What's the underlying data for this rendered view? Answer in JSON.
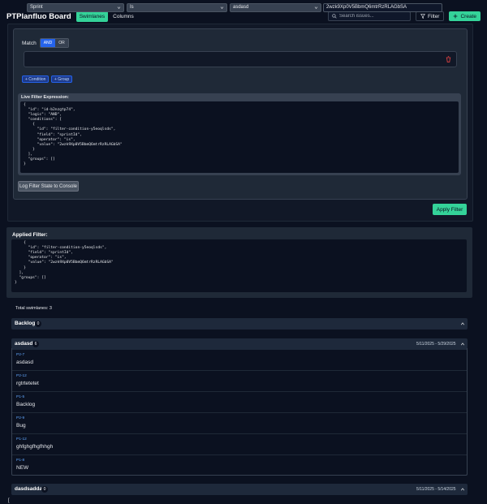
{
  "header": {
    "title": "PTPlanfluo Board",
    "views": [
      "Swimlanes",
      "Columns"
    ],
    "active_view": "Swimlanes",
    "search_placeholder": "Search issues...",
    "filter_label": "Filter",
    "create_label": "Create"
  },
  "builder": {
    "match_label": "Match",
    "logic_options": [
      "AND",
      "OR"
    ],
    "active_logic": "AND",
    "condition": {
      "field": "Sprint",
      "operator": "Is",
      "value_select": "asdasd",
      "value_input": "2wzk9Xp0V5BbmQ6mtrRzRLAGbSA"
    },
    "add_condition_label": "+ Condition",
    "add_group_label": "+ Group",
    "live_title": "Live Filter Expression:",
    "live_json": "{\n  \"id\": \"id-b2nzgtp74\",\n  \"logic\": \"AND\",\n  \"conditions\": [\n    {\n      \"id\": \"filter-condition-y5eoqlsds\",\n      \"field\": \"sprintId\",\n      \"operator\": \"is\",\n      \"value\": \"2wzk9Xp0V5BbmQ6mtrRzRLAGbSA\"\n    }\n  ],\n  \"groups\": []\n}",
    "log_label": "Log Filter State to Console",
    "apply_label": "Apply Filter"
  },
  "applied": {
    "title": "Applied Filter:",
    "json": "  \"conditions\": [\n    {\n      \"id\": \"filter-condition-y5eoqlsds\",\n      \"field\": \"sprintId\",\n      \"operator\": \"is\",\n      \"value\": \"2wzk9Xp0V5BbmQ6mtrRzRLAGbSA\"\n    }\n  ],\n  \"groups\": []\n}"
  },
  "total_text": "Total swimlanes: 3",
  "lanes": [
    {
      "name": "Backlog",
      "count": "0",
      "dates": ""
    },
    {
      "name": "asdasd",
      "count": "6",
      "dates": "5/11/2025 - 5/29/2025"
    },
    {
      "name": "dasdsadda",
      "count": "0",
      "dates": "5/11/2025 - 5/14/2025"
    }
  ],
  "issues": [
    {
      "key": "P2-7",
      "title": "asdasd"
    },
    {
      "key": "P2-12",
      "title": "rgtrtetetet"
    },
    {
      "key": "P1-5",
      "title": "Backlog"
    },
    {
      "key": "P2-9",
      "title": "Bug"
    },
    {
      "key": "P1-12",
      "title": "ghfghgfhgfhhgh"
    },
    {
      "key": "P1-8",
      "title": "NEW"
    }
  ],
  "footer_glyph": "[",
  "colors": {
    "accent": "#34d399",
    "primary": "#2563eb",
    "link": "#60a5fa",
    "danger": "#ef4444",
    "background": "#0b1120"
  },
  "icons": [
    "search-icon",
    "filter-icon",
    "plus-icon",
    "chevron-down-icon",
    "trash-icon",
    "chevron-up-icon"
  ]
}
